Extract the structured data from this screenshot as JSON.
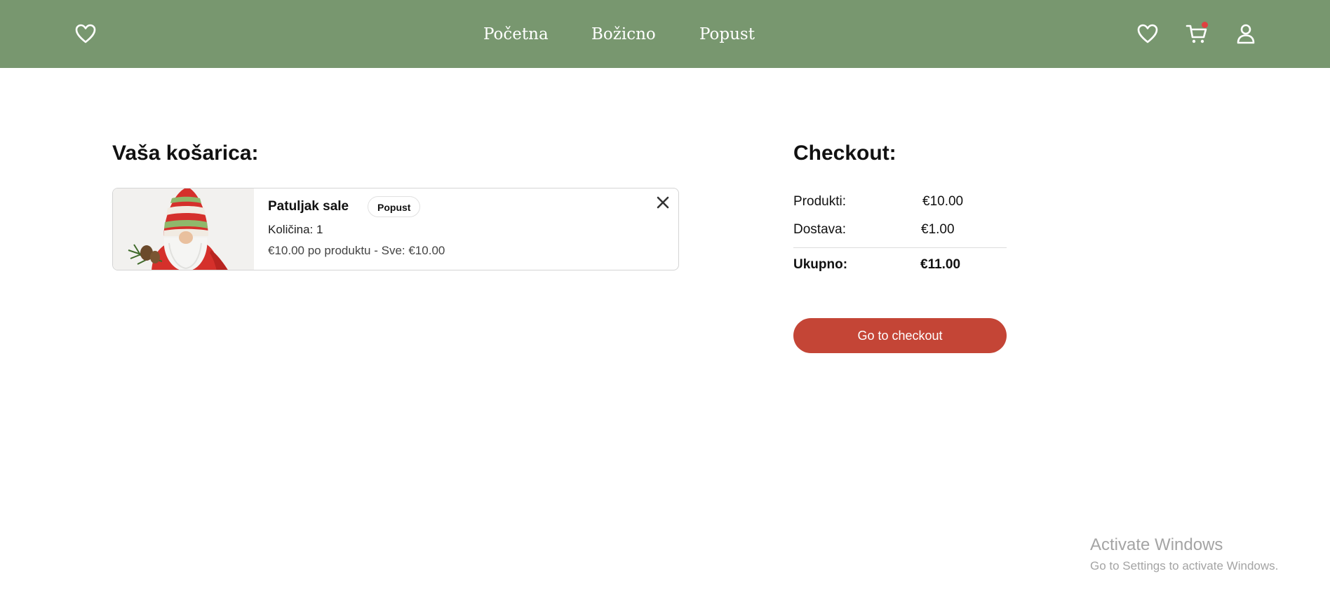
{
  "colors": {
    "header_bg": "#78976f",
    "accent": "#c44536",
    "notification_dot": "#e04040"
  },
  "nav": {
    "logo_icon": "heart-outline-icon",
    "links": [
      "Početna",
      "Božicno",
      "Popust"
    ],
    "icons": [
      "heart-outline-icon",
      "shopping-cart-icon",
      "user-icon"
    ]
  },
  "cart": {
    "title": "Vaša košarica:",
    "items": [
      {
        "name": "Patuljak sale",
        "badge": "Popust",
        "quantity_text": "Količina: 1",
        "price_text": "€10.00 po produktu - Sve: €10.00",
        "image": "christmas-gnome-image"
      }
    ]
  },
  "checkout": {
    "title": "Checkout:",
    "rows": [
      {
        "label": "Produkti:",
        "value": "€10.00"
      },
      {
        "label": "Dostava:",
        "value": "€1.00"
      }
    ],
    "total": {
      "label": "Ukupno:",
      "value": "€11.00"
    },
    "button_label": "Go to checkout"
  },
  "os_overlay": {
    "title": "Activate Windows",
    "subtitle": "Go to Settings to activate Windows."
  }
}
